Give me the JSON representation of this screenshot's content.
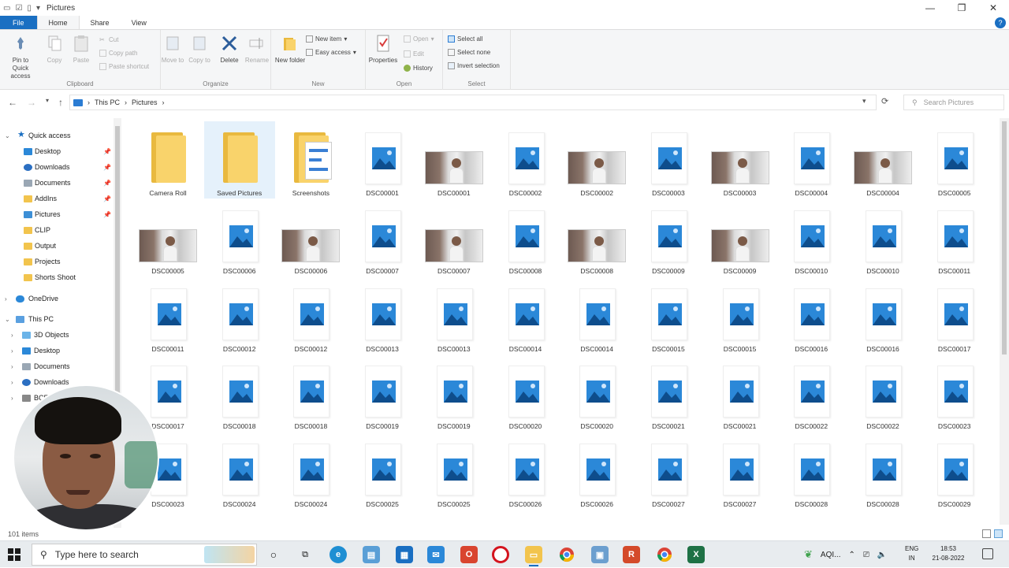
{
  "window": {
    "title": "Pictures",
    "controls": {
      "minimize": "—",
      "maximize": "❐",
      "close": "✕"
    }
  },
  "ribbon_tabs": [
    {
      "label": "File"
    },
    {
      "label": "Home"
    },
    {
      "label": "Share"
    },
    {
      "label": "View"
    }
  ],
  "help_label": "?",
  "ribbon": {
    "clipboard": {
      "group": "Clipboard",
      "pin": "Pin to Quick access",
      "copy": "Copy",
      "paste": "Paste",
      "cut": "Cut",
      "copy_path": "Copy path",
      "paste_shortcut": "Paste shortcut"
    },
    "organize": {
      "group": "Organize",
      "move_to": "Move to",
      "copy_to": "Copy to",
      "delete": "Delete",
      "rename": "Rename"
    },
    "new": {
      "group": "New",
      "new_folder": "New folder",
      "new_item": "New item",
      "easy_access": "Easy access"
    },
    "open": {
      "group": "Open",
      "properties": "Properties",
      "open": "Open",
      "edit": "Edit",
      "history": "History"
    },
    "select": {
      "group": "Select",
      "select_all": "Select all",
      "select_none": "Select none",
      "invert": "Invert selection"
    }
  },
  "address": {
    "breadcrumb": [
      "This PC",
      "Pictures"
    ],
    "separator": "›",
    "search_placeholder": "Search Pictures"
  },
  "nav": {
    "quick_access": "Quick access",
    "quick_items": [
      "Desktop",
      "Downloads",
      "Documents",
      "AddIns",
      "Pictures",
      "CLIP",
      "Output",
      "Projects",
      "Shorts Shoot"
    ],
    "onedrive": "OneDrive",
    "this_pc": "This PC",
    "pc_items": [
      "3D Objects",
      "Desktop",
      "Documents",
      "Downloads"
    ],
    "partial_item": "BCE"
  },
  "files": [
    {
      "name": "Camera Roll",
      "kind": "folder"
    },
    {
      "name": "Saved Pictures",
      "kind": "folder",
      "selected": true
    },
    {
      "name": "Screenshots",
      "kind": "folder-shots"
    },
    {
      "name": "DSC00001",
      "kind": "image"
    },
    {
      "name": "DSC00001",
      "kind": "photo"
    },
    {
      "name": "DSC00002",
      "kind": "image"
    },
    {
      "name": "DSC00002",
      "kind": "photo"
    },
    {
      "name": "DSC00003",
      "kind": "image"
    },
    {
      "name": "DSC00003",
      "kind": "photo"
    },
    {
      "name": "DSC00004",
      "kind": "image"
    },
    {
      "name": "DSC00004",
      "kind": "photo"
    },
    {
      "name": "DSC00005",
      "kind": "image"
    },
    {
      "name": "DSC00005",
      "kind": "photo"
    },
    {
      "name": "DSC00006",
      "kind": "image"
    },
    {
      "name": "DSC00006",
      "kind": "photo"
    },
    {
      "name": "DSC00007",
      "kind": "image"
    },
    {
      "name": "DSC00007",
      "kind": "photo"
    },
    {
      "name": "DSC00008",
      "kind": "image"
    },
    {
      "name": "DSC00008",
      "kind": "photo"
    },
    {
      "name": "DSC00009",
      "kind": "image"
    },
    {
      "name": "DSC00009",
      "kind": "photo"
    },
    {
      "name": "DSC00010",
      "kind": "image"
    },
    {
      "name": "DSC00010",
      "kind": "image"
    },
    {
      "name": "DSC00011",
      "kind": "image"
    },
    {
      "name": "DSC00011",
      "kind": "image"
    },
    {
      "name": "DSC00012",
      "kind": "image"
    },
    {
      "name": "DSC00012",
      "kind": "image"
    },
    {
      "name": "DSC00013",
      "kind": "image"
    },
    {
      "name": "DSC00013",
      "kind": "image"
    },
    {
      "name": "DSC00014",
      "kind": "image"
    },
    {
      "name": "DSC00014",
      "kind": "image"
    },
    {
      "name": "DSC00015",
      "kind": "image"
    },
    {
      "name": "DSC00015",
      "kind": "image"
    },
    {
      "name": "DSC00016",
      "kind": "image"
    },
    {
      "name": "DSC00016",
      "kind": "image"
    },
    {
      "name": "DSC00017",
      "kind": "image"
    },
    {
      "name": "DSC00017",
      "kind": "image"
    },
    {
      "name": "DSC00018",
      "kind": "image"
    },
    {
      "name": "DSC00018",
      "kind": "image"
    },
    {
      "name": "DSC00019",
      "kind": "image"
    },
    {
      "name": "DSC00019",
      "kind": "image"
    },
    {
      "name": "DSC00020",
      "kind": "image"
    },
    {
      "name": "DSC00020",
      "kind": "image"
    },
    {
      "name": "DSC00021",
      "kind": "image"
    },
    {
      "name": "DSC00021",
      "kind": "image"
    },
    {
      "name": "DSC00022",
      "kind": "image"
    },
    {
      "name": "DSC00022",
      "kind": "image"
    },
    {
      "name": "DSC00023",
      "kind": "image"
    },
    {
      "name": "DSC00023",
      "kind": "image"
    },
    {
      "name": "DSC00024",
      "kind": "image"
    },
    {
      "name": "DSC00024",
      "kind": "image"
    },
    {
      "name": "DSC00025",
      "kind": "image"
    },
    {
      "name": "DSC00025",
      "kind": "image"
    },
    {
      "name": "DSC00026",
      "kind": "image"
    },
    {
      "name": "DSC00026",
      "kind": "image"
    },
    {
      "name": "DSC00027",
      "kind": "image"
    },
    {
      "name": "DSC00027",
      "kind": "image"
    },
    {
      "name": "DSC00028",
      "kind": "image"
    },
    {
      "name": "DSC00028",
      "kind": "image"
    },
    {
      "name": "DSC00029",
      "kind": "image"
    }
  ],
  "status": {
    "items": "101 items"
  },
  "taskbar": {
    "search_placeholder": "Type here to search",
    "tray_text": "AQI...",
    "lang1": "ENG",
    "lang2": "IN",
    "time": "18:53",
    "date": "21-08-2022"
  },
  "colors": {
    "accent": "#1a6fc2",
    "selection": "#e5f1fb",
    "folder": "#f9d36b",
    "image_icon": "#2b88d8"
  }
}
